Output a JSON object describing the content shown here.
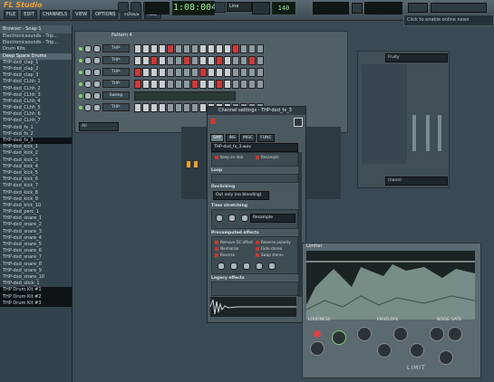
{
  "app": {
    "title": "FL Studio"
  },
  "menu": [
    "FILE",
    "EDIT",
    "CHANNELS",
    "VIEW",
    "OPTIONS",
    "TOOLS",
    "HELP"
  ],
  "transport": {
    "time": "1:08:004",
    "mode": "Line",
    "tempo": "140",
    "online": "Click to enable online news"
  },
  "browser": {
    "header": "Browser - Snap 1",
    "items": [
      {
        "label": "Electronicsounds - Trip...",
        "style": "normal"
      },
      {
        "label": "Electronicsounds - Trip...",
        "style": "normal"
      },
      {
        "label": "Drum Kits",
        "style": "normal"
      },
      {
        "label": "Deep Space Drums",
        "style": "sel"
      },
      {
        "label": "THP-dxd_clap_1",
        "style": "normal"
      },
      {
        "label": "THP-dxd_clap_2",
        "style": "normal"
      },
      {
        "label": "THP-dxd_clap_3",
        "style": "normal"
      },
      {
        "label": "THP-dxd_CLhh_1",
        "style": "normal"
      },
      {
        "label": "THP-dxd_CLhh_2",
        "style": "normal"
      },
      {
        "label": "THP-dxd_CLhh_3",
        "style": "normal"
      },
      {
        "label": "THP-dxd_CLhh_4",
        "style": "normal"
      },
      {
        "label": "THP-dxd_CLhh_5",
        "style": "normal"
      },
      {
        "label": "THP-dxd_CLhh_6",
        "style": "normal"
      },
      {
        "label": "THP-dxd_CLhh_7",
        "style": "normal"
      },
      {
        "label": "THP-dxd_fx_1",
        "style": "normal"
      },
      {
        "label": "THP-dxd_fx_2",
        "style": "normal"
      },
      {
        "label": "THP-dxd_fx_3",
        "style": "dark"
      },
      {
        "label": "THP-dxd_kick_1",
        "style": "normal"
      },
      {
        "label": "THP-dxd_kick_2",
        "style": "normal"
      },
      {
        "label": "THP-dxd_kick_3",
        "style": "normal"
      },
      {
        "label": "THP-dxd_kick_4",
        "style": "normal"
      },
      {
        "label": "THP-dxd_kick_5",
        "style": "normal"
      },
      {
        "label": "THP-dxd_kick_6",
        "style": "normal"
      },
      {
        "label": "THP-dxd_kick_7",
        "style": "normal"
      },
      {
        "label": "THP-dxd_kick_8",
        "style": "normal"
      },
      {
        "label": "THP-dxd_kick_9",
        "style": "normal"
      },
      {
        "label": "THP-dxd_kick_10",
        "style": "normal"
      },
      {
        "label": "THP-dxd_perc_1",
        "style": "normal"
      },
      {
        "label": "THP-dxd_snare_1",
        "style": "normal"
      },
      {
        "label": "THP-dxd_snare_2",
        "style": "normal"
      },
      {
        "label": "THP-dxd_snare_3",
        "style": "normal"
      },
      {
        "label": "THP-dxd_snare_4",
        "style": "normal"
      },
      {
        "label": "THP-dxd_snare_5",
        "style": "normal"
      },
      {
        "label": "THP-dxd_snare_6",
        "style": "normal"
      },
      {
        "label": "THP-dxd_snare_7",
        "style": "normal"
      },
      {
        "label": "THP-dxd_snare_8",
        "style": "normal"
      },
      {
        "label": "THP-dxd_snare_9",
        "style": "normal"
      },
      {
        "label": "THP-dxd_snare_10",
        "style": "normal"
      },
      {
        "label": "THP-dxd_stick_1",
        "style": "normal"
      },
      {
        "label": "THP Drum Kit #1",
        "style": "dark"
      },
      {
        "label": "THP Drum Kit #2",
        "style": "dark"
      },
      {
        "label": "THP Drum Kit #3",
        "style": "dark"
      }
    ]
  },
  "stepseq": {
    "title": "Pattern 4",
    "channels": [
      {
        "name": "THP-dxd_clap_1",
        "steps": [
          0,
          0,
          0,
          0,
          1,
          0,
          0,
          0,
          0,
          0,
          0,
          0,
          1,
          0,
          0,
          0
        ]
      },
      {
        "name": "THP-dxd_CLhh_1",
        "steps": [
          0,
          0,
          1,
          0,
          0,
          0,
          1,
          0,
          0,
          0,
          1,
          0,
          0,
          0,
          1,
          0
        ]
      },
      {
        "name": "THP-dxd_CLhh_2",
        "steps": [
          1,
          0,
          0,
          0,
          0,
          0,
          0,
          0,
          1,
          0,
          0,
          0,
          0,
          0,
          0,
          0
        ]
      },
      {
        "name": "THP-dxd_kick_1",
        "steps": [
          1,
          0,
          0,
          0,
          0,
          0,
          0,
          1,
          0,
          0,
          1,
          0,
          0,
          0,
          0,
          0
        ]
      },
      {
        "name": "Sweep",
        "steps": [
          0,
          0,
          0,
          0,
          0,
          0,
          0,
          0,
          0,
          0,
          0,
          0,
          0,
          0,
          0,
          0
        ]
      },
      {
        "name": "THP-dxd_fx_3",
        "steps": [
          0,
          0,
          0,
          0,
          0,
          0,
          0,
          0,
          0,
          0,
          0,
          0,
          0,
          0,
          0,
          0
        ]
      }
    ],
    "filter": "All"
  },
  "channel_settings": {
    "title": "Channel settings - THP-dxd_fx_3",
    "tabs": [
      "SMP",
      "INS",
      "MISC",
      "FUNC"
    ],
    "sample_name": "THP-dxd_fx_3.wav",
    "keep_on_disk": "Keep on disk",
    "resample": "Resample",
    "loop_label": "Loop",
    "declicking_label": "Declicking",
    "declicking_value": "Out only (no bleeding)",
    "time_stretch_label": "Time stretching",
    "time_stretch_mode": "Resample",
    "precomputed_label": "Precomputed effects",
    "effects": [
      "Remove DC offset",
      "Normalize",
      "Reverse",
      "Reverse polarity",
      "Fade stereo",
      "Swap stereo"
    ],
    "legacy_label": "Legacy effects"
  },
  "mixer": {
    "insert_label": "(none)",
    "track_label": "Fruity"
  },
  "limiter": {
    "title": "Limiter",
    "loudness": "LOUDNESS",
    "envelope": "ENVELOPE",
    "noise_gate": "NOISE GATE",
    "brand": "LIMIT"
  },
  "fx_colors": {
    "accent": "#f0a030",
    "step_on": "#c93a3a",
    "lcd": "#9cf29c"
  }
}
